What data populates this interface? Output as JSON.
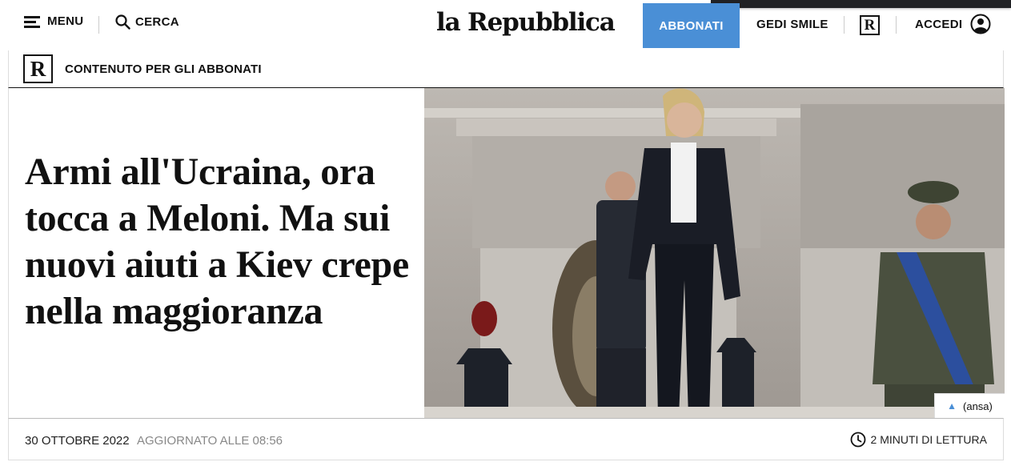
{
  "header": {
    "menu_label": "MENU",
    "search_label": "CERCA",
    "logo_text": "la Repubblica",
    "subscribe_label": "ABBONATI",
    "gedi_label": "GEDI SMILE",
    "r_badge": "R",
    "login_label": "ACCEDI",
    "icons": {
      "menu": "hamburger-icon",
      "search": "search-icon",
      "login": "user-icon"
    }
  },
  "ribbon": {
    "badge": "R",
    "text": "CONTENUTO PER GLI ABBONATI"
  },
  "article": {
    "headline": "Armi all'Ucraina, ora tocca a Meloni. Ma sui nuovi aiuti a Kiev crepe nella maggioranza",
    "photo_credit": "(ansa)",
    "date": "30 OTTOBRE 2022",
    "updated": "AGGIORNATO ALLE 08:56",
    "read_time": "2 MINUTI DI LETTURA",
    "icons": {
      "credit": "triangle-up-icon",
      "read_time": "clock-icon"
    }
  },
  "colors": {
    "accent": "#4a8fd6",
    "text": "#111111",
    "muted": "#888888"
  }
}
